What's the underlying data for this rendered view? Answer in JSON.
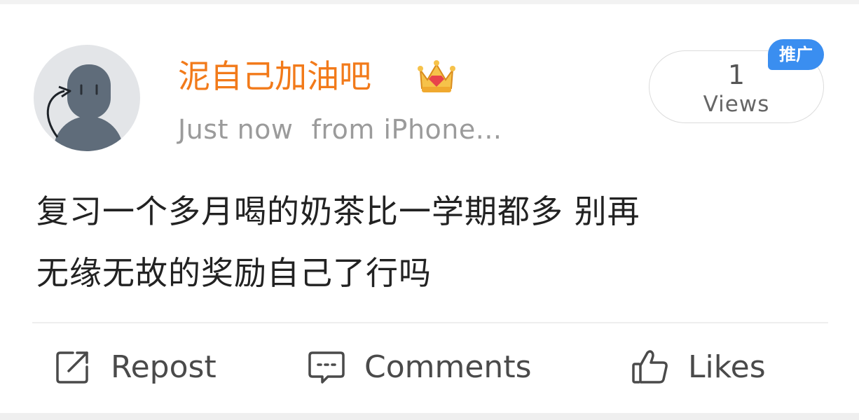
{
  "post": {
    "author": {
      "name": "泥自己加油吧",
      "badge": "crown-icon"
    },
    "meta": {
      "time": "Just now",
      "source": "from iPhone..."
    },
    "views": {
      "count": "1",
      "label": "Views"
    },
    "promo_tag": "推广",
    "content": {
      "lines": [
        "复习一个多月喝的奶茶比一学期都多 别再",
        "无缘无故的奖励自己了行吗"
      ]
    }
  },
  "actions": {
    "repost": {
      "label": "Repost",
      "icon": "repost-icon"
    },
    "comments": {
      "label": "Comments",
      "icon": "comment-icon"
    },
    "likes": {
      "label": "Likes",
      "icon": "thumbs-up-icon"
    }
  },
  "colors": {
    "username": "#f27a1a",
    "promo": "#3a8ef0",
    "meta": "#9b9b9b",
    "text": "#222222"
  }
}
